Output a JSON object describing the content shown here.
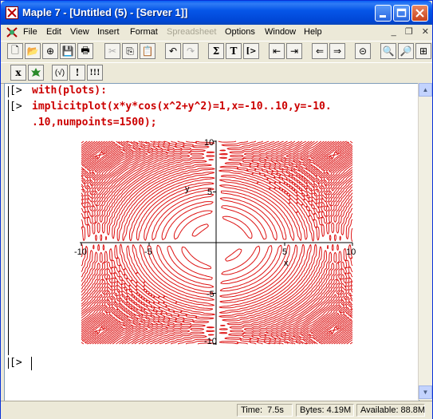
{
  "window": {
    "title": "Maple 7  - [Untitled (5) - [Server 1]]"
  },
  "menubar": {
    "items": [
      {
        "label": "File",
        "enabled": true
      },
      {
        "label": "Edit",
        "enabled": true
      },
      {
        "label": "View",
        "enabled": true
      },
      {
        "label": "Insert",
        "enabled": true
      },
      {
        "label": "Format",
        "enabled": true
      },
      {
        "label": "Spreadsheet",
        "enabled": false
      },
      {
        "label": "Options",
        "enabled": true
      },
      {
        "label": "Window",
        "enabled": true
      },
      {
        "label": "Help",
        "enabled": true
      }
    ]
  },
  "toolbar": {
    "sum_label": "Σ",
    "text_label": "T",
    "exec_label": "[>",
    "context": [
      "x",
      "(√)",
      "!",
      "!!!"
    ]
  },
  "worksheet": {
    "prompt": "[>",
    "cmd1": "with(plots):",
    "cmd2_line1": "implicitplot(x*y*cos(x^2+y^2)=1,x=-10..10,y=-10.",
    "cmd2_line2": ".10,numpoints=1500);"
  },
  "plot": {
    "x_ticks": [
      "-10",
      "-5",
      "5",
      "10"
    ],
    "y_ticks": [
      "10",
      "5",
      "-5",
      "-10"
    ],
    "xlabel": "x",
    "ylabel": "y",
    "curve_color": "#dd1111"
  },
  "chart_data": {
    "type": "line",
    "title": "",
    "xlabel": "x",
    "ylabel": "y",
    "xlim": [
      -10,
      10
    ],
    "ylim": [
      -10,
      10
    ],
    "x_ticks": [
      -10,
      -5,
      5,
      10
    ],
    "y_ticks": [
      -10,
      -5,
      5,
      10
    ],
    "equation": "x*y*cos(x^2+y^2)=1",
    "grid": false,
    "legend": "none"
  },
  "statusbar": {
    "time_label": "Time:",
    "time_value": "7.5s",
    "bytes_label": "Bytes:",
    "bytes_value": "4.19M",
    "avail_label": "Available:",
    "avail_value": "88.8M"
  }
}
